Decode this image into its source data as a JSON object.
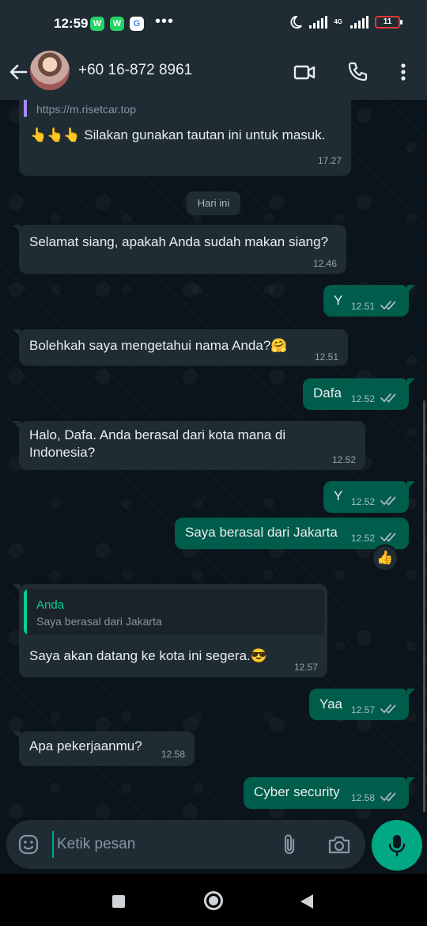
{
  "status_bar": {
    "time": "12:59",
    "apps": [
      "W",
      "W",
      "G"
    ],
    "dots": "•••",
    "network": "4G",
    "battery": "11"
  },
  "header": {
    "contact": "+60 16-872 8961"
  },
  "chat": {
    "link_url": "https://m.risetcar.top",
    "date_divider": "Hari ini",
    "messages": [
      {
        "dir": "in",
        "text": "👆👆👆 Silakan gunakan tautan ini untuk masuk.",
        "time": "17.27"
      },
      {
        "dir": "in",
        "text": "Selamat siang, apakah Anda sudah makan siang?",
        "time": "12.46"
      },
      {
        "dir": "out",
        "text": "Y",
        "time": "12.51"
      },
      {
        "dir": "in",
        "text": "Bolehkah saya mengetahui nama Anda?🤗",
        "time": "12.51"
      },
      {
        "dir": "out",
        "text": "Dafa",
        "time": "12.52"
      },
      {
        "dir": "in",
        "text": "Halo, Dafa. Anda berasal dari kota mana di Indonesia?",
        "time": "12.52"
      },
      {
        "dir": "out",
        "text": "Y",
        "time": "12.52"
      },
      {
        "dir": "out",
        "text": "Saya berasal dari Jakarta",
        "time": "12.52"
      },
      {
        "dir": "in",
        "text": "Saya akan datang ke kota ini segera.😎",
        "time": "12.57"
      },
      {
        "dir": "out",
        "text": "Yaa",
        "time": "12.57"
      },
      {
        "dir": "in",
        "text": "Apa pekerjaanmu?",
        "time": "12.58"
      },
      {
        "dir": "out",
        "text": "Cyber security",
        "time": "12.58"
      }
    ],
    "reaction": "👍",
    "quote": {
      "name": "Anda",
      "text": "Saya berasal dari Jakarta"
    }
  },
  "composer": {
    "placeholder": "Ketik pesan"
  },
  "colors": {
    "background": "#0b141a",
    "incoming": "#1f2c34",
    "outgoing": "#005c4b",
    "accent": "#00a884"
  },
  "icons": [
    "back-arrow-icon",
    "video-call-icon",
    "phone-icon",
    "more-icon",
    "emoji-icon",
    "attach-icon",
    "camera-icon",
    "mic-icon",
    "double-check-icon"
  ]
}
